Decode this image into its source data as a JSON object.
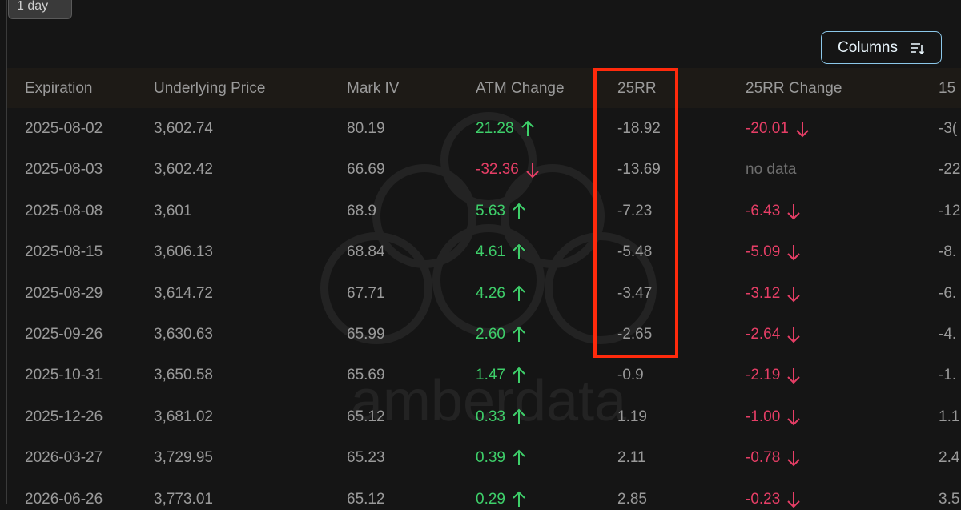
{
  "range_selector": {
    "label": "1 day"
  },
  "toolbar": {
    "columns_label": "Columns"
  },
  "watermark": {
    "text": "amberdata"
  },
  "table": {
    "headers": [
      "Expiration",
      "Underlying Price",
      "Mark IV",
      "ATM Change",
      "25RR",
      "25RR Change",
      "15"
    ],
    "rows": [
      {
        "expiration": "2025-08-02",
        "underlying": "3,602.74",
        "mark_iv": "80.19",
        "atm_change": "21.28",
        "atm_dir": "up",
        "rr25": "-18.92",
        "rr25_change": "-20.01",
        "rr25_dir": "down",
        "next": "-3("
      },
      {
        "expiration": "2025-08-03",
        "underlying": "3,602.42",
        "mark_iv": "66.69",
        "atm_change": "-32.36",
        "atm_dir": "down",
        "rr25": "-13.69",
        "rr25_change": "no data",
        "rr25_dir": "none",
        "next": "-22"
      },
      {
        "expiration": "2025-08-08",
        "underlying": "3,601",
        "mark_iv": "68.9",
        "atm_change": "5.63",
        "atm_dir": "up",
        "rr25": "-7.23",
        "rr25_change": "-6.43",
        "rr25_dir": "down",
        "next": "-12"
      },
      {
        "expiration": "2025-08-15",
        "underlying": "3,606.13",
        "mark_iv": "68.84",
        "atm_change": "4.61",
        "atm_dir": "up",
        "rr25": "-5.48",
        "rr25_change": "-5.09",
        "rr25_dir": "down",
        "next": "-8."
      },
      {
        "expiration": "2025-08-29",
        "underlying": "3,614.72",
        "mark_iv": "67.71",
        "atm_change": "4.26",
        "atm_dir": "up",
        "rr25": "-3.47",
        "rr25_change": "-3.12",
        "rr25_dir": "down",
        "next": "-6."
      },
      {
        "expiration": "2025-09-26",
        "underlying": "3,630.63",
        "mark_iv": "65.99",
        "atm_change": "2.60",
        "atm_dir": "up",
        "rr25": "-2.65",
        "rr25_change": "-2.64",
        "rr25_dir": "down",
        "next": "-4."
      },
      {
        "expiration": "2025-10-31",
        "underlying": "3,650.58",
        "mark_iv": "65.69",
        "atm_change": "1.47",
        "atm_dir": "up",
        "rr25": "-0.9",
        "rr25_change": "-2.19",
        "rr25_dir": "down",
        "next": "-1."
      },
      {
        "expiration": "2025-12-26",
        "underlying": "3,681.02",
        "mark_iv": "65.12",
        "atm_change": "0.33",
        "atm_dir": "up",
        "rr25": "1.19",
        "rr25_change": "-1.00",
        "rr25_dir": "down",
        "next": "1.1"
      },
      {
        "expiration": "2026-03-27",
        "underlying": "3,729.95",
        "mark_iv": "65.23",
        "atm_change": "0.39",
        "atm_dir": "up",
        "rr25": "2.11",
        "rr25_change": "-0.78",
        "rr25_dir": "down",
        "next": "2.4"
      },
      {
        "expiration": "2026-06-26",
        "underlying": "3,773.01",
        "mark_iv": "65.12",
        "atm_change": "0.29",
        "atm_dir": "up",
        "rr25": "2.85",
        "rr25_change": "-0.23",
        "rr25_dir": "down",
        "next": "3.5"
      }
    ]
  },
  "colors": {
    "positive": "#3ecf6a",
    "negative": "#e63e66",
    "highlight": "#ff2a0c",
    "accent": "#8cc8ea"
  }
}
